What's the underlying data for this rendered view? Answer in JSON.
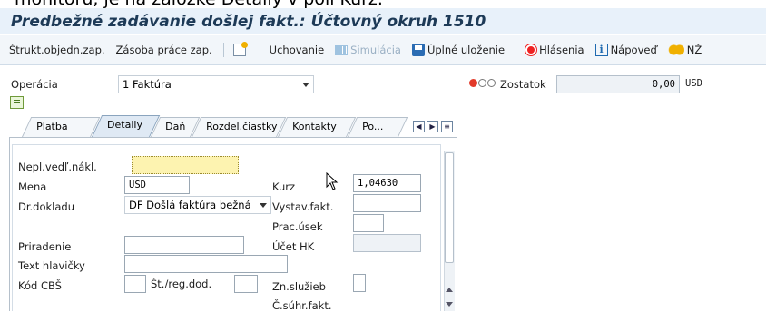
{
  "caption": "monitoru, je na záložke Detaily v poli Kurz.",
  "title": "Predbežné zadávanie došlej fakt.: Účtovný okruh 1510",
  "toolbar": {
    "items": [
      {
        "label": "Štrukt.objedn.zap."
      },
      {
        "label": "Zásoba práce zap."
      },
      {
        "label": "Uchovanie"
      },
      {
        "label": "Simulácia"
      },
      {
        "label": "Úplné uloženie"
      },
      {
        "label": "Hlásenia"
      },
      {
        "label": "Nápoveď"
      },
      {
        "label": "NŽ"
      }
    ]
  },
  "header": {
    "operation_label": "Operácia",
    "operation_value": "1 Faktúra",
    "balance_label": "Zostatok",
    "balance_value": "0,00",
    "balance_currency": "USD"
  },
  "tabs": [
    "Platba",
    "Detaily",
    "Daň",
    "Rozdel.čiastky",
    "Kontakty",
    "Po..."
  ],
  "active_tab": "Detaily",
  "form": {
    "unplanned_costs_label": "Nepl.vedľ.nákl.",
    "unplanned_costs_value": "",
    "currency_label": "Mena",
    "currency_value": "USD",
    "doc_type_label": "Dr.dokladu",
    "doc_type_value": "DF Došlá faktúra bežná",
    "assignment_label": "Priradenie",
    "header_text_label": "Text hlavičky",
    "cbs_code_label": "Kód CBŠ",
    "st_reg_label": "Št./reg.dod.",
    "rate_label": "Kurz",
    "rate_value": "1,04630",
    "issuer_label": "Vystav.fakt.",
    "work_section_label": "Prac.úsek",
    "gl_account_label": "Účet HK",
    "services_label": "Zn.služieb",
    "summary_invoice_label": "Č.súhr.fakt."
  }
}
